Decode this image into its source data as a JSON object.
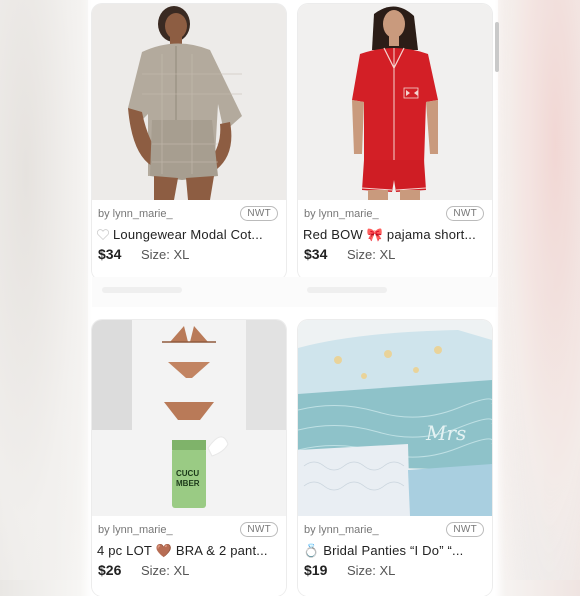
{
  "listings": [
    {
      "seller": "by lynn_marie_",
      "condition": "NWT",
      "title": "Loungewear Modal Cot...",
      "price": "$34",
      "size": "Size: XL",
      "icon": "white-heart-icon"
    },
    {
      "seller": "by lynn_marie_",
      "condition": "NWT",
      "title": "Red BOW 🎀 pajama short...",
      "price": "$34",
      "size": "Size: XL"
    },
    {
      "seller": "by lynn_marie_",
      "condition": "NWT",
      "title": "4 pc LOT 🤎 BRA & 2 pant...",
      "price": "$26",
      "size": "Size: XL"
    },
    {
      "seller": "by lynn_marie_",
      "condition": "NWT",
      "title": "💍 Bridal Panties  “I Do” “...",
      "price": "$19",
      "size": "Size: XL"
    }
  ],
  "product_labels": {
    "tube_line1": "CUCU",
    "tube_line2": "MBER",
    "lace_script": "Mrs"
  }
}
